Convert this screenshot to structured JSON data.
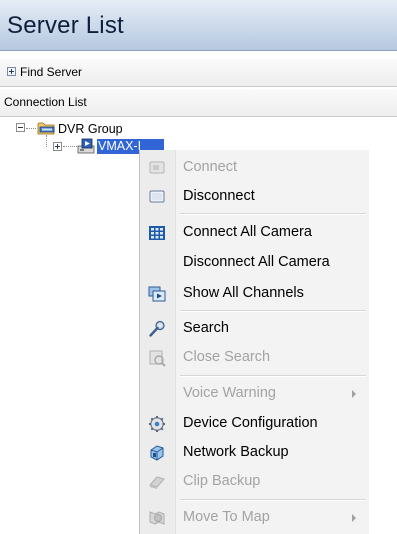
{
  "panel": {
    "title": "Server List",
    "find_server_label": "Find Server",
    "connection_list_label": "Connection List"
  },
  "tree": {
    "group_label": "DVR Group",
    "selected_item_label": "VMAX-I"
  },
  "context_menu": {
    "items": [
      {
        "label": "Connect",
        "enabled": false,
        "icon": "connect-icon"
      },
      {
        "label": "Disconnect",
        "enabled": true,
        "icon": "disconnect-icon"
      },
      {
        "label": "Connect All Camera",
        "enabled": true,
        "icon": "grid-camera-icon"
      },
      {
        "label": "Disconnect All Camera",
        "enabled": true,
        "icon": ""
      },
      {
        "label": "Show All Channels",
        "enabled": true,
        "icon": "channels-icon"
      },
      {
        "label": "Search",
        "enabled": true,
        "icon": "search-wrench-icon"
      },
      {
        "label": "Close Search",
        "enabled": false,
        "icon": "close-search-icon"
      },
      {
        "label": "Voice Warning",
        "enabled": false,
        "icon": "",
        "submenu": true
      },
      {
        "label": "Device Configuration",
        "enabled": true,
        "icon": "gear-icon"
      },
      {
        "label": "Network Backup",
        "enabled": true,
        "icon": "network-backup-icon"
      },
      {
        "label": "Clip Backup",
        "enabled": false,
        "icon": "clip-backup-icon"
      },
      {
        "label": "Move To Map",
        "enabled": false,
        "icon": "map-icon",
        "submenu": true
      }
    ]
  },
  "colors": {
    "title_bar": "#cfdcec",
    "selection": "#3165d6",
    "menu_bg": "#f3f3f3",
    "disabled_text": "#a3a3a3"
  }
}
